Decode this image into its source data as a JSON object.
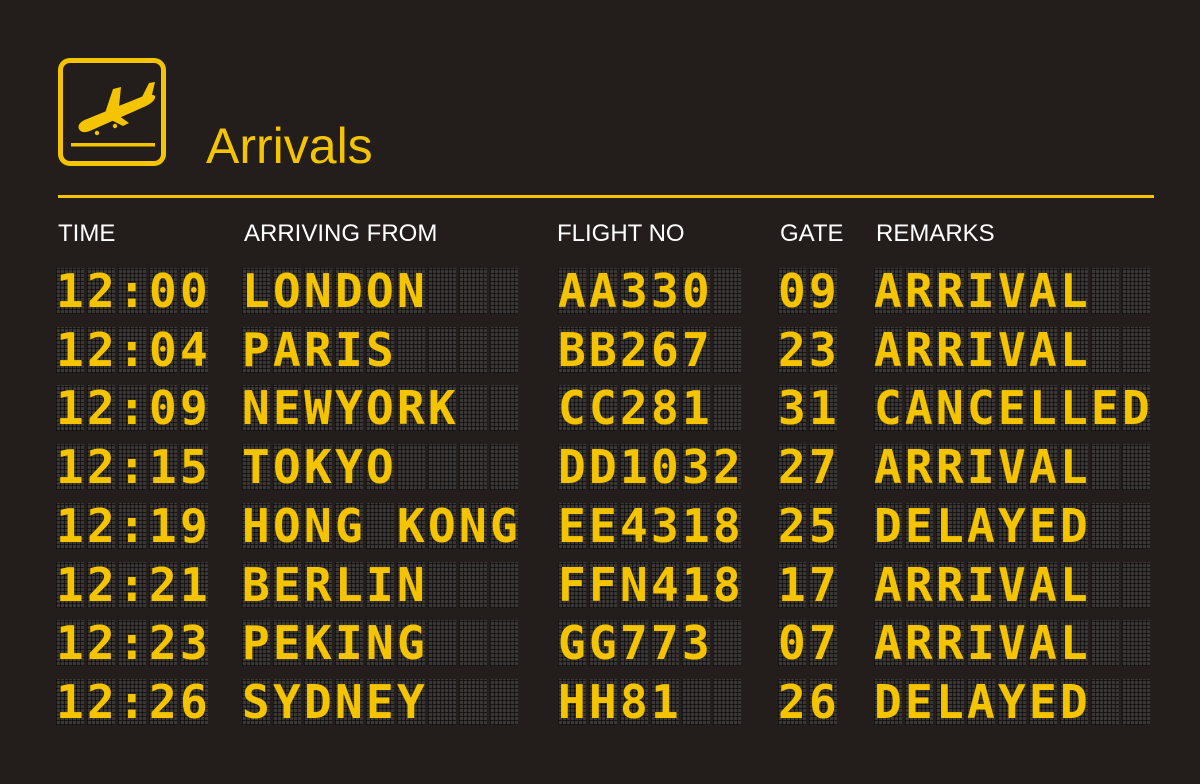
{
  "header": {
    "title": "Arrivals",
    "icon": "plane-landing-icon"
  },
  "columns": {
    "time": "TIME",
    "from": "ARRIVING FROM",
    "flight": "FLIGHT NO",
    "gate": "GATE",
    "remarks": "REMARKS"
  },
  "colors": {
    "accent": "#f5c400",
    "background": "#231d1b",
    "header_text": "#ffffff",
    "tile": "#3a3634"
  },
  "rows": [
    {
      "time": "12:00",
      "from": "LONDON",
      "flight": "AA330",
      "gate": "09",
      "remarks": "ARRIVAL"
    },
    {
      "time": "12:04",
      "from": "PARIS",
      "flight": "BB267",
      "gate": "23",
      "remarks": "ARRIVAL"
    },
    {
      "time": "12:09",
      "from": "NEWYORK",
      "flight": "CC281",
      "gate": "31",
      "remarks": "CANCELLED"
    },
    {
      "time": "12:15",
      "from": "TOKYO",
      "flight": "DD1032",
      "gate": "27",
      "remarks": "ARRIVAL"
    },
    {
      "time": "12:19",
      "from": "HONG KONG",
      "flight": "EE4318",
      "gate": "25",
      "remarks": "DELAYED"
    },
    {
      "time": "12:21",
      "from": "BERLIN",
      "flight": "FFN418",
      "gate": "17",
      "remarks": "ARRIVAL"
    },
    {
      "time": "12:23",
      "from": "PEKING",
      "flight": "GG773",
      "gate": "07",
      "remarks": "ARRIVAL"
    },
    {
      "time": "12:26",
      "from": "SYDNEY",
      "flight": "HH81",
      "gate": "26",
      "remarks": "DELAYED"
    }
  ]
}
